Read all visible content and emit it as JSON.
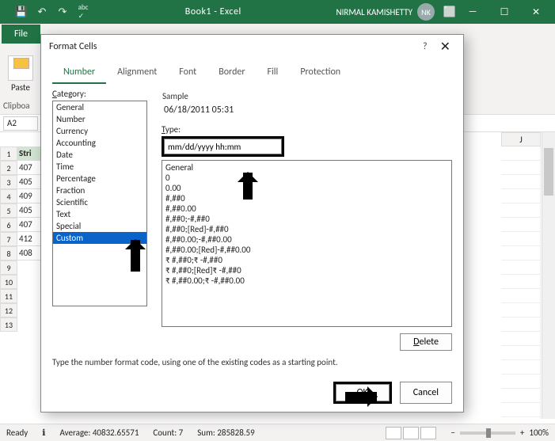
{
  "titlebar": {
    "book": "Book1 - Excel",
    "user": "NIRMAL KAMISHETTY",
    "avatar": "NK"
  },
  "ribbon": {
    "file": "File",
    "paste": "Paste",
    "clipboard": "Clipboa"
  },
  "namebox": "A2",
  "grid": {
    "column_header_right": "J",
    "row_numbers": [
      1,
      2,
      3,
      4,
      5,
      6,
      7,
      8,
      9,
      10,
      11,
      12,
      13
    ],
    "partial_col_header": "Stri",
    "partial_col_values": [
      "407",
      "405",
      "409",
      "405",
      "407",
      "412",
      "408"
    ]
  },
  "statusbar": {
    "mode": "Ready",
    "acc": "",
    "average_label": "Average:",
    "average": "40832.65571",
    "count_label": "Count:",
    "count": "7",
    "sum_label": "Sum:",
    "sum": "285828.59",
    "zoom_minus": "−",
    "zoom_plus": "+",
    "zoom": "100%"
  },
  "dialog": {
    "title": "Format Cells",
    "help": "?",
    "close": "✕",
    "tabs": [
      "Number",
      "Alignment",
      "Font",
      "Border",
      "Fill",
      "Protection"
    ],
    "category_label": "Category:",
    "categories": [
      "General",
      "Number",
      "Currency",
      "Accounting",
      "Date",
      "Time",
      "Percentage",
      "Fraction",
      "Scientific",
      "Text",
      "Special",
      "Custom"
    ],
    "selected_category": "Custom",
    "sample_label": "Sample",
    "sample_value": "06/18/2011 05:31",
    "type_label": "Type:",
    "type_value": "mm/dd/yyyy hh:mm",
    "format_list": [
      "General",
      "0",
      "0.00",
      "#,##0",
      "#,##0.00",
      "#,##0;-#,##0",
      "#,##0;[Red]-#,##0",
      "#,##0.00;-#,##0.00",
      "#,##0.00;[Red]-#,##0.00",
      "₹ #,##0;₹ -#,##0",
      "₹ #,##0;[Red]₹ -#,##0",
      "₹ #,##0.00;₹ -#,##0.00"
    ],
    "delete": "Delete",
    "hint": "Type the number format code, using one of the existing codes as a starting point.",
    "ok": "OK",
    "cancel": "Cancel"
  }
}
